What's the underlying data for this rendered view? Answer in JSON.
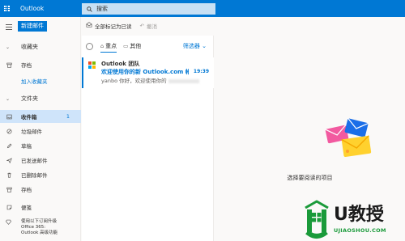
{
  "app": {
    "title": "Outlook"
  },
  "search": {
    "placeholder": "搜索"
  },
  "left_nav": {
    "new_mail_label": "新建邮件",
    "favorites_label": "收藏夹",
    "favorites_items": [
      {
        "label": "存档",
        "icon": "archive-icon"
      }
    ],
    "add_favorite_label": "加入收藏夹",
    "folders_label": "文件夹",
    "folders": [
      {
        "label": "收件箱",
        "icon": "inbox-icon",
        "count": "1",
        "selected": true
      },
      {
        "label": "垃圾邮件",
        "icon": "junk-icon"
      },
      {
        "label": "草稿",
        "icon": "pencil-icon"
      },
      {
        "label": "已发送邮件",
        "icon": "send-icon"
      },
      {
        "label": "已删除邮件",
        "icon": "trash-icon"
      },
      {
        "label": "存档",
        "icon": "archive-icon"
      },
      {
        "label": "便笺",
        "icon": "note-icon"
      }
    ],
    "promo_text_lines": [
      "使用以下订阅升级",
      "Office 365:",
      "Outlook 高级功能"
    ]
  },
  "command_bar": {
    "mark_all_read": "全部标记为已读",
    "undo": "撤消"
  },
  "message_list": {
    "tabs": [
      {
        "label": "重点",
        "icon": "focused-icon"
      },
      {
        "label": "其他",
        "icon": "other-icon"
      }
    ],
    "filter_label": "筛选器",
    "messages": [
      {
        "sender": "Outlook 团队",
        "subject": "欢迎使用你的新 Outlook.com 帐户",
        "time": "19:39",
        "preview": "yanbo 你好，欢迎使用你的"
      }
    ]
  },
  "reading_pane": {
    "empty_text": "选择要阅读的项目"
  },
  "watermark": {
    "brand": "U教授",
    "url": "UJIAOSHOU.COM"
  },
  "colors": {
    "accent": "#0078d4",
    "selected_bg": "#cfe4fa",
    "watermark_green": "#1a9a3a"
  }
}
